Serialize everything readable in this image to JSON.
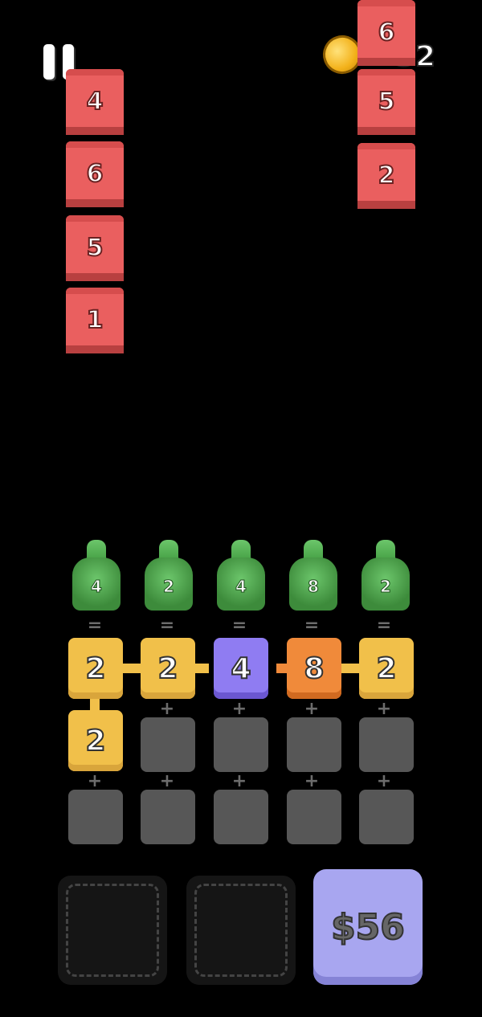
{
  "hud": {
    "pause_icon": "pause-icon",
    "coins": "32"
  },
  "left_stack": [
    "4",
    "6",
    "5",
    "1"
  ],
  "right_stack": [
    "6",
    "5",
    "2"
  ],
  "bottles": [
    "4",
    "2",
    "4",
    "8",
    "2"
  ],
  "grid": {
    "row1": [
      "2",
      "2",
      "4",
      "8",
      "2"
    ],
    "row2": [
      "2"
    ]
  },
  "shop": {
    "price": "$56"
  },
  "colors": {
    "tile_red": "#ea5f5f",
    "yellow": "#f1c04a",
    "purple": "#8f7cf2",
    "orange": "#f08a3a",
    "green": "#4aa948"
  }
}
